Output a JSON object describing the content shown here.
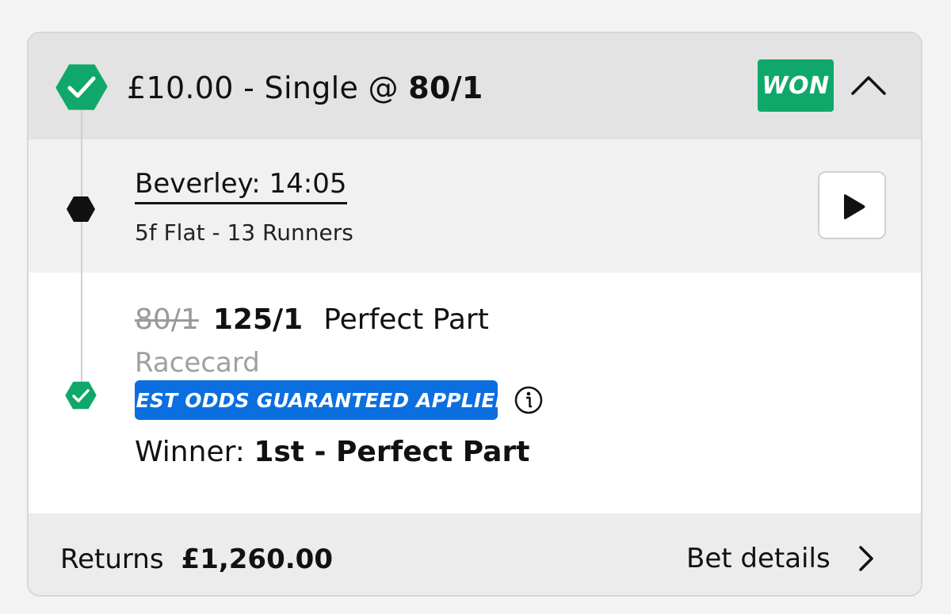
{
  "bet": {
    "stake": "£10.00",
    "separator": " - ",
    "bet_type": "Single @ ",
    "odds": "80/1",
    "status": "WON"
  },
  "race": {
    "title": "Beverley: 14:05",
    "info": "5f  Flat - 13 Runners"
  },
  "selection": {
    "original_odds": "80/1",
    "final_odds": "125/1",
    "name": "Perfect Part",
    "racecard_label": "Racecard",
    "bog_label": "BEST ODDS GUARANTEED APPLIED",
    "result_label": "Winner: ",
    "result_value": "1st - Perfect Part"
  },
  "footer": {
    "returns_label": "Returns",
    "returns_value": "£1,260.00",
    "details_label": "Bet details"
  },
  "colors": {
    "won_green": "#0fa86a",
    "bog_blue": "#0b6fe0",
    "header_bg": "#e3e3e3"
  },
  "icons": {
    "status": "check-hexagon-icon",
    "collapse": "chevron-up-icon",
    "race": "hexagon-dot-icon",
    "play": "play-icon",
    "selection": "check-hexagon-icon",
    "info": "info-circle-icon",
    "details": "chevron-right-icon"
  }
}
